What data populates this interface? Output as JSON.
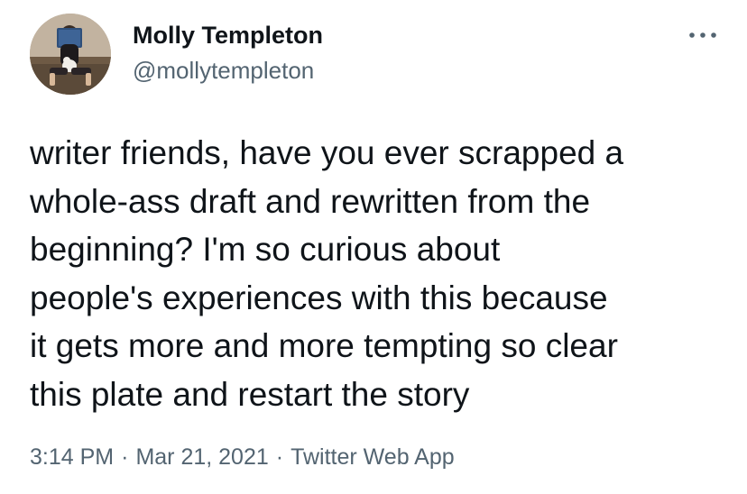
{
  "author": {
    "display_name": "Molly Templeton",
    "handle": "@mollytempleton",
    "avatar_icon": "profile-photo"
  },
  "more_icon": "more-horizontal-icon",
  "tweet": {
    "lines": [
      "writer friends, have you ever scrapped a",
      "whole-ass draft and rewritten from the",
      "beginning? I'm so curious about",
      "people's experiences with this because",
      "it gets more and more tempting so clear",
      "this plate and restart the story"
    ]
  },
  "meta": {
    "time": "3:14 PM",
    "separator": "·",
    "date": "Mar 21, 2021",
    "source": "Twitter Web App"
  },
  "colors": {
    "text": "#0f1419",
    "secondary": "#536471",
    "background": "#ffffff"
  }
}
